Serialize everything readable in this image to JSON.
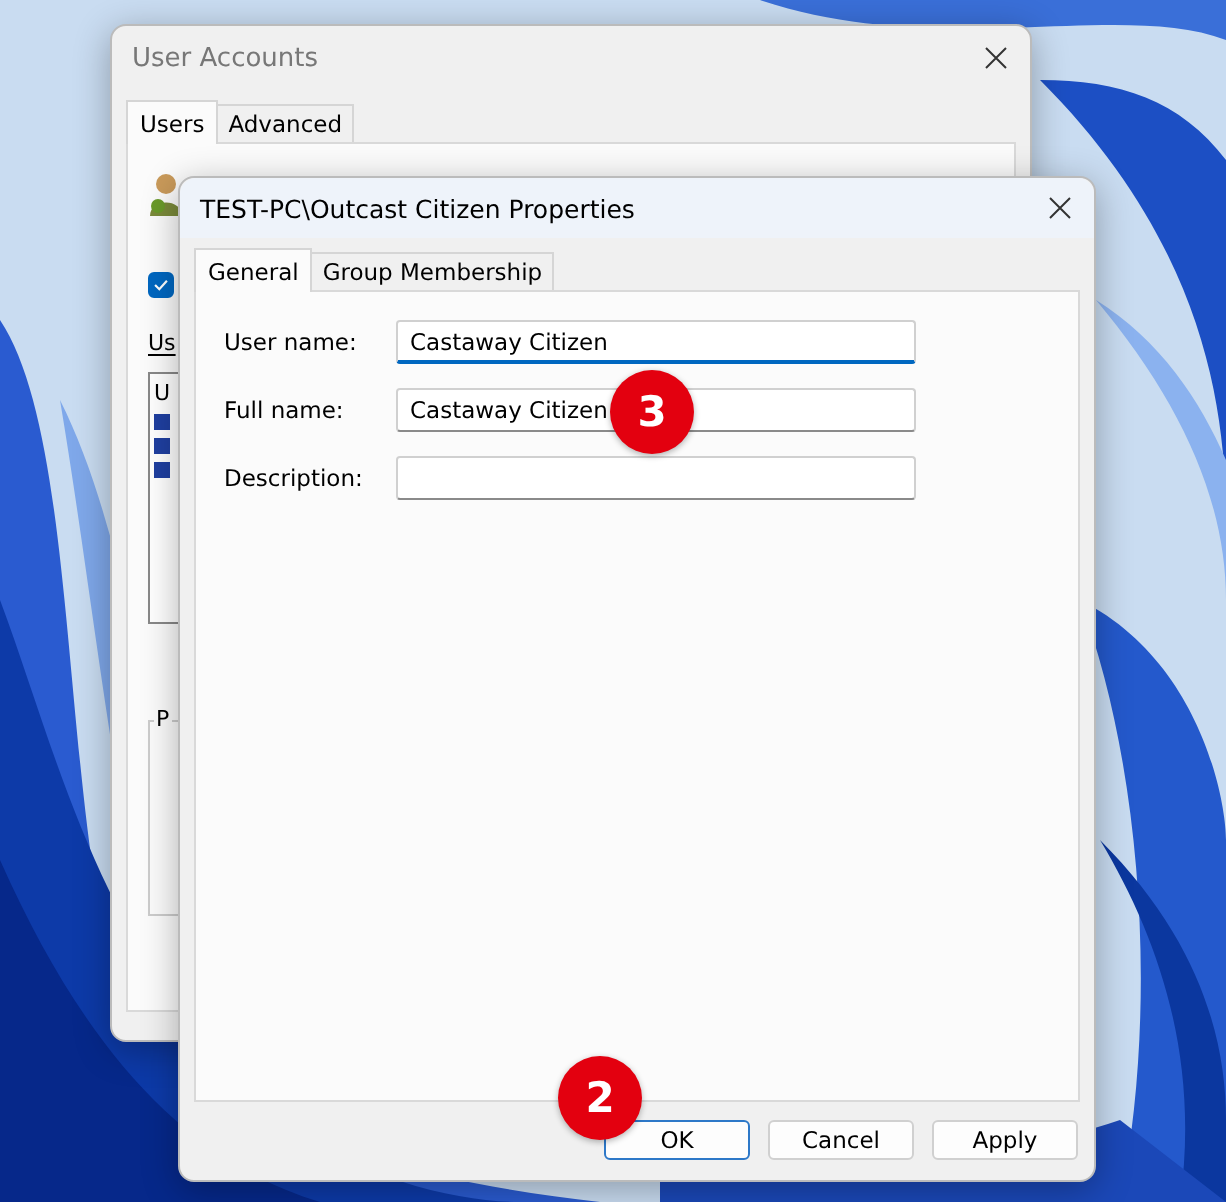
{
  "back_window": {
    "title": "User Accounts",
    "tabs": [
      {
        "label": "Users",
        "selected": true
      },
      {
        "label": "Advanced",
        "selected": false
      }
    ],
    "checkbox": {
      "checked": true
    },
    "list_label": "Us",
    "list_header": "U",
    "group_label": "P"
  },
  "dialog": {
    "title": "TEST-PC\\Outcast Citizen Properties",
    "tabs": [
      {
        "label": "General",
        "selected": true
      },
      {
        "label": "Group Membership",
        "selected": false
      }
    ],
    "fields": [
      {
        "label": "User name:",
        "value": "Castaway Citizen",
        "focused": true
      },
      {
        "label": "Full name:",
        "value": "Castaway Citizen",
        "focused": false
      },
      {
        "label": "Description:",
        "focused": false
      }
    ],
    "buttons": [
      {
        "label": "OK",
        "default": true
      },
      {
        "label": "Cancel",
        "default": false
      },
      {
        "label": "Apply",
        "default": false
      }
    ]
  },
  "annotations": [
    "3",
    "2"
  ]
}
